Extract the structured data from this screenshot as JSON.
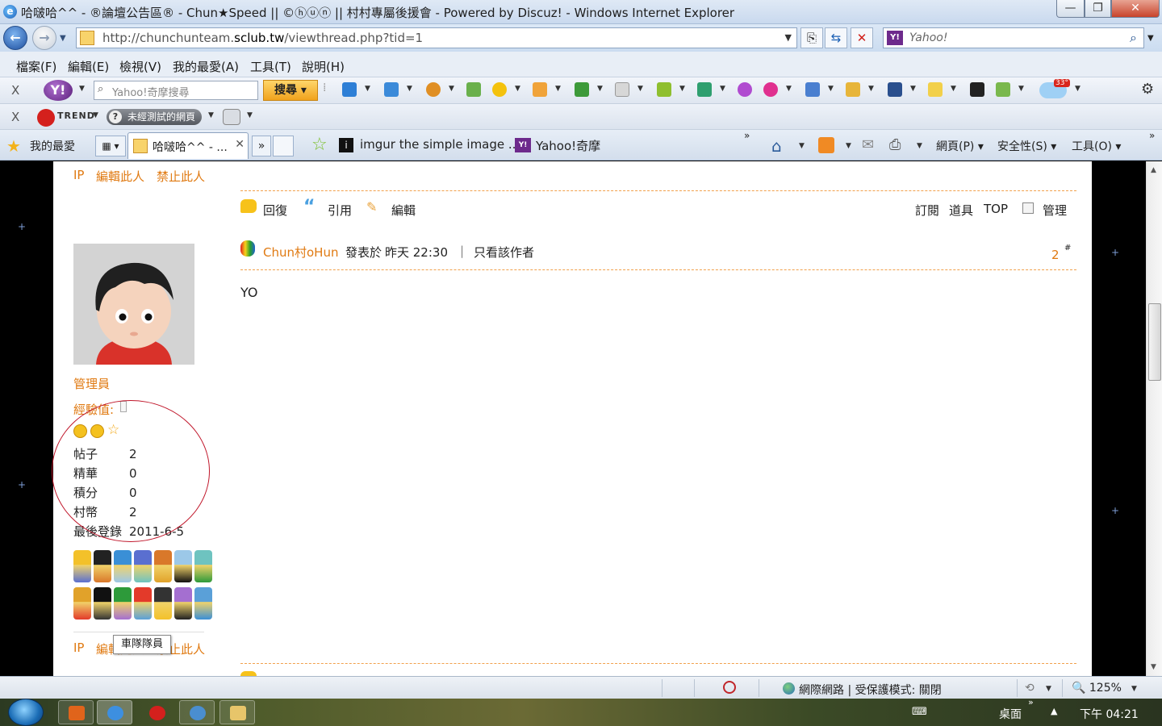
{
  "window": {
    "title": "哈啵哈^^ - ®論壇公告區® - Chun★Speed || ©ⓗⓤⓝ || 村村專屬後援會 - Powered by Discuz! - Windows Internet Explorer",
    "min": "—",
    "max": "❐",
    "close": "✕"
  },
  "address": {
    "url_prefix": "http://chunchunteam.",
    "url_domain": "sclub.tw",
    "url_suffix": "/viewthread.php?tid=1",
    "search_placeholder": "Yahoo!",
    "yahoo_badge": "Y!"
  },
  "menu": [
    "檔案(F)",
    "編輯(E)",
    "檢視(V)",
    "我的最愛(A)",
    "工具(T)",
    "說明(H)"
  ],
  "yahoo_toolbar": {
    "close": "X",
    "logo": "Y!",
    "search_placeholder": "Yahoo!奇摩搜尋",
    "search_button": "搜尋",
    "weather_temp": "33°"
  },
  "trend_toolbar": {
    "close": "X",
    "brand": "TREND",
    "brand_sub": "MICRO",
    "status": "未經測試的網頁"
  },
  "tabs": {
    "favorites_label": "我的最愛",
    "active_tab": "哈啵哈^^ - ...",
    "more": "»",
    "fav_links": [
      "imgur the simple image ...",
      "Yahoo!奇摩"
    ],
    "commands": [
      "網頁(P)",
      "安全性(S)",
      "工具(O)"
    ]
  },
  "post_top": {
    "ip": "IP",
    "edit_user": "編輯此人",
    "ban_user": "禁止此人"
  },
  "actions": {
    "reply": "回復",
    "quote": "引用",
    "edit": "編輯",
    "subscribe": "訂閱",
    "tools": "道具",
    "top": "TOP",
    "manage": "管理"
  },
  "post": {
    "author": "Chun村oHun",
    "posted_label": "發表於",
    "posted_time": "昨天 22:30",
    "separator": "|",
    "only_author": "只看該作者",
    "floor": "2",
    "floor_mark": "#",
    "content": "YO"
  },
  "profile": {
    "role": "管理員",
    "exp_label": "經驗值:",
    "stats": [
      {
        "label": "帖子",
        "value": "2"
      },
      {
        "label": "精華",
        "value": "0"
      },
      {
        "label": "積分",
        "value": "0"
      },
      {
        "label": "村幣",
        "value": "2"
      },
      {
        "label": "最後登錄",
        "value": "2011-6-5"
      }
    ],
    "tooltip": "車隊隊員"
  },
  "status_bar": {
    "zone": "網際網路 | 受保護模式: 關閉",
    "zoom": "125%"
  },
  "taskbar": {
    "desktop": "桌面",
    "clock": "下午 04:21"
  },
  "colors": {
    "accent_orange": "#e07a12",
    "annotation_red": "#c0162a",
    "page_bg": "#ffffff",
    "outer_bg": "#000000"
  },
  "icons": {
    "reply": "speech-bubble-icon",
    "quote": "quote-icon",
    "edit": "pencil-icon",
    "manage": "checkbox-icon"
  }
}
